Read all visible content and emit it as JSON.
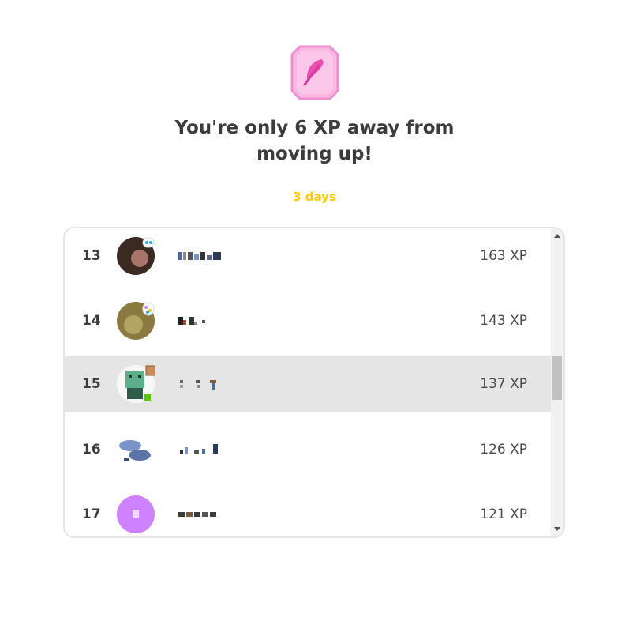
{
  "league_badge": {
    "icon": "feather-icon",
    "color": "#f6a4d9"
  },
  "headline": "You're only 6 XP away from moving up!",
  "time_left": "3 days",
  "leaderboard": {
    "rows": [
      {
        "rank": "13",
        "xp": "163 XP",
        "avatar_color": "#3a2a22",
        "current": false
      },
      {
        "rank": "14",
        "xp": "143 XP",
        "avatar_color": "#8a7a40",
        "current": false
      },
      {
        "rank": "15",
        "xp": "137 XP",
        "avatar_color": "#5bb08a",
        "current": true
      },
      {
        "rank": "16",
        "xp": "126 XP",
        "avatar_color": "#7b93c8",
        "current": false
      },
      {
        "rank": "17",
        "xp": "121 XP",
        "avatar_color": "#ce82ff",
        "current": false
      }
    ]
  },
  "colors": {
    "timer": "#ffc800",
    "highlight_row": "#e5e5e5"
  }
}
